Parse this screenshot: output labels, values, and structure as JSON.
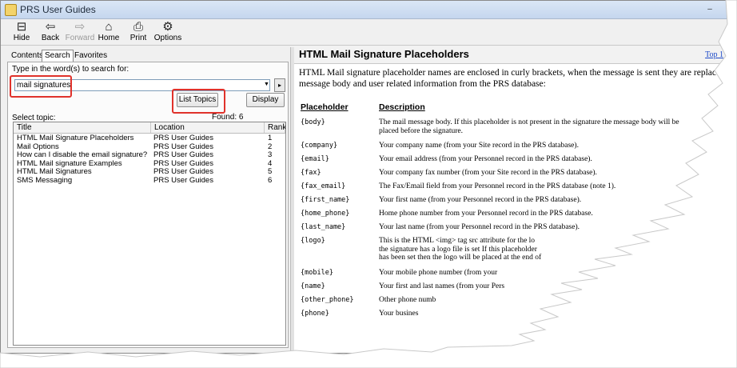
{
  "window": {
    "title": "PRS User Guides",
    "controls": {
      "minimize": "–",
      "close": "✕"
    }
  },
  "toolbar": {
    "buttons": [
      {
        "label": "Hide",
        "icon": "hide-icon",
        "glyph": "⊟",
        "enabled": true
      },
      {
        "label": "Back",
        "icon": "back-arrow-icon",
        "glyph": "⇦",
        "enabled": true
      },
      {
        "label": "Forward",
        "icon": "forward-arrow-icon",
        "glyph": "⇨",
        "enabled": false
      },
      {
        "label": "Home",
        "icon": "home-icon",
        "glyph": "⌂",
        "enabled": true
      },
      {
        "label": "Print",
        "icon": "printer-icon",
        "glyph": "⎙",
        "enabled": true
      },
      {
        "label": "Options",
        "icon": "options-icon",
        "glyph": "⚙",
        "enabled": true
      }
    ]
  },
  "nav": {
    "tabs": [
      {
        "label": "Contents",
        "active": false
      },
      {
        "label": "Search",
        "active": true
      },
      {
        "label": "Favorites",
        "active": false
      }
    ],
    "search_prompt": "Type in the word(s) to search for:",
    "search_value": "mail signatures",
    "combo_arrow": "▼",
    "go_glyph": "▸",
    "list_topics_label": "List Topics",
    "display_label": "Display",
    "select_topic_label": "Select topic:",
    "found_label": "Found: 6",
    "columns": [
      "Title",
      "Location",
      "Rank"
    ],
    "results": [
      {
        "title": "HTML Mail Signature Placeholders",
        "location": "PRS User Guides",
        "rank": "1"
      },
      {
        "title": "Mail Options",
        "location": "PRS User Guides",
        "rank": "2"
      },
      {
        "title": "How can I disable the email signature?",
        "location": "PRS User Guides",
        "rank": "3"
      },
      {
        "title": "HTML Mail signature Examples",
        "location": "PRS User Guides",
        "rank": "4"
      },
      {
        "title": "HTML Mail Signatures",
        "location": "PRS User Guides",
        "rank": "5"
      },
      {
        "title": "SMS Messaging",
        "location": "PRS User Guides",
        "rank": "6"
      }
    ]
  },
  "content": {
    "title": "HTML Mail Signature Placeholders",
    "top_link": "Top 1",
    "intro_line1": "HTML Mail signature placeholder names are enclosed in curly brackets, when the message is sent they are replaced",
    "intro_line2": "message body and user related information from the PRS database:",
    "placeholder_header": "Placeholder",
    "description_header": "Description",
    "rows": [
      {
        "ph": "{body}",
        "d1": "The mail message body. If this placeholder is not present in the signature the message body will be",
        "d2": "placed before the signature."
      },
      {
        "ph": "{company}",
        "d1": "Your company name (from your Site record in the PRS database).",
        "d2": ""
      },
      {
        "ph": "{email}",
        "d1": "Your email address (from your Personnel record in the PRS database).",
        "d2": ""
      },
      {
        "ph": "{fax}",
        "d1": "Your company fax number (from your Site record in the PRS database).",
        "d2": ""
      },
      {
        "ph": "{fax_email}",
        "d1": "The Fax/Email field from your Personnel record in the PRS database (note 1).",
        "d2": ""
      },
      {
        "ph": "{first_name}",
        "d1": "Your first name (from your Personnel record in the PRS database).",
        "d2": ""
      },
      {
        "ph": "{home_phone}",
        "d1": "Home phone number from your Personnel record in the PRS database.",
        "d2": ""
      },
      {
        "ph": "{last_name}",
        "d1": "Your last name (from your Personnel record in the PRS database).",
        "d2": ""
      },
      {
        "ph": "{logo}",
        "d1": "This is the HTML <img> tag src attribute for the lo",
        "d2": "the signature has a logo file is set  If this placeholder",
        "d3": "has been set then the logo will be placed at the end of"
      },
      {
        "ph": "{mobile}",
        "d1": "Your mobile phone number (from your",
        "d2": ""
      },
      {
        "ph": "{name}",
        "d1": "Your first and last names (from your Pers",
        "d2": ""
      },
      {
        "ph": "{other_phone}",
        "d1": "Other phone numb",
        "d2": ""
      },
      {
        "ph": "{phone}",
        "d1": "Your busines",
        "d2": ""
      }
    ]
  }
}
